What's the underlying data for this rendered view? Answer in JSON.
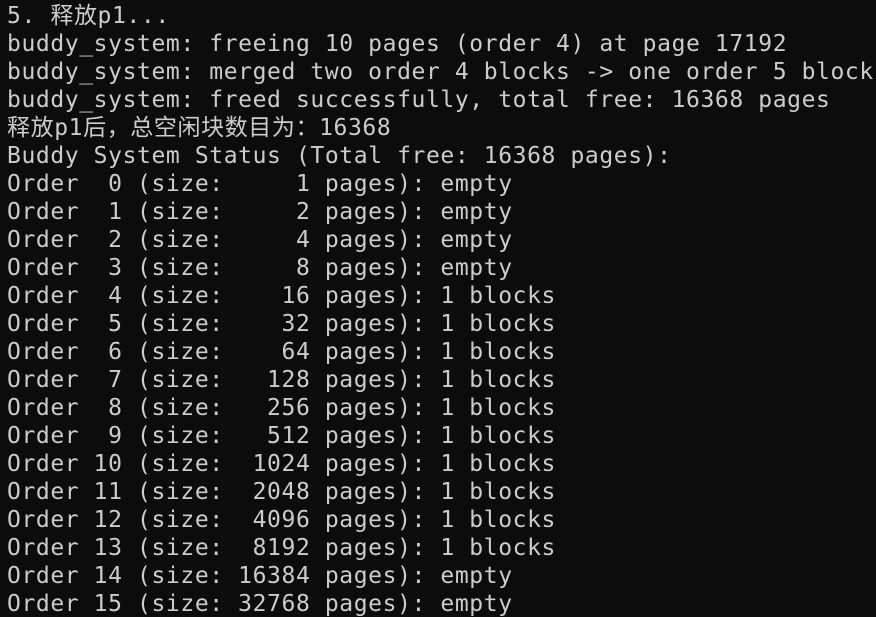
{
  "terminal": {
    "lines": [
      "5. 释放p1...",
      "buddy_system: freeing 10 pages (order 4) at page 17192",
      "buddy_system: merged two order 4 blocks -> one order 5 block",
      "buddy_system: freed successfully, total free: 16368 pages",
      "释放p1后，总空闲块数目为：16368",
      "Buddy System Status (Total free: 16368 pages):",
      "Order  0 (size:     1 pages): empty",
      "Order  1 (size:     2 pages): empty",
      "Order  2 (size:     4 pages): empty",
      "Order  3 (size:     8 pages): empty",
      "Order  4 (size:    16 pages): 1 blocks",
      "Order  5 (size:    32 pages): 1 blocks",
      "Order  6 (size:    64 pages): 1 blocks",
      "Order  7 (size:   128 pages): 1 blocks",
      "Order  8 (size:   256 pages): 1 blocks",
      "Order  9 (size:   512 pages): 1 blocks",
      "Order 10 (size:  1024 pages): 1 blocks",
      "Order 11 (size:  2048 pages): 1 blocks",
      "Order 12 (size:  4096 pages): 1 blocks",
      "Order 13 (size:  8192 pages): 1 blocks",
      "Order 14 (size: 16384 pages): empty",
      "Order 15 (size: 32768 pages): empty"
    ]
  },
  "colors": {
    "background": "#0c0c0c",
    "foreground": "#cccccc"
  }
}
